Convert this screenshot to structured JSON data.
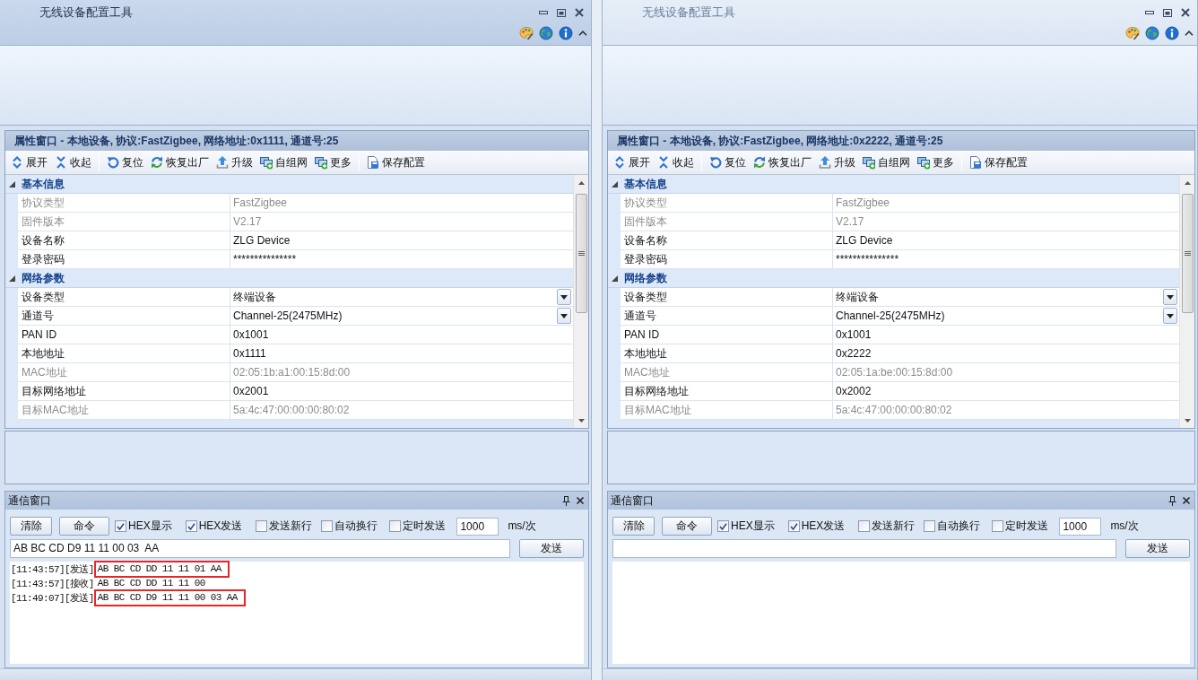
{
  "windows": [
    {
      "title": "无线设备配置工具",
      "active": true,
      "property_panel": {
        "header": "属性窗口 - 本地设备, 协议:FastZigbee, 网络地址:0x1111, 通道号:25",
        "toolbar_groups": [
          {
            "items": [
              {
                "kind": "expand",
                "label": "展开"
              },
              {
                "kind": "collapse",
                "label": "收起"
              }
            ]
          },
          {
            "items": [
              {
                "kind": "reset",
                "label": "复位"
              },
              {
                "kind": "restore",
                "label": "恢复出厂"
              },
              {
                "kind": "upgrade",
                "label": "升级"
              },
              {
                "kind": "network",
                "label": "自组网"
              },
              {
                "kind": "more",
                "label": "更多"
              }
            ]
          },
          {
            "items": [
              {
                "kind": "save",
                "label": "保存配置"
              }
            ]
          }
        ],
        "groups": [
          {
            "name": "基本信息",
            "expanded": true,
            "rows": [
              {
                "name": "协议类型",
                "value": "FastZigbee",
                "disabled": true,
                "dropdown": false
              },
              {
                "name": "固件版本",
                "value": "V2.17",
                "disabled": true,
                "dropdown": false
              },
              {
                "name": "设备名称",
                "value": "ZLG Device",
                "disabled": false,
                "dropdown": false
              },
              {
                "name": "登录密码",
                "value": "***************",
                "disabled": false,
                "dropdown": false
              }
            ]
          },
          {
            "name": "网络参数",
            "expanded": true,
            "rows": [
              {
                "name": "设备类型",
                "value": "终端设备",
                "disabled": false,
                "dropdown": true
              },
              {
                "name": "通道号",
                "value": "Channel-25(2475MHz)",
                "disabled": false,
                "dropdown": true
              },
              {
                "name": "PAN ID",
                "value": "0x1001",
                "disabled": false,
                "dropdown": false
              },
              {
                "name": "本地地址",
                "value": "0x1111",
                "disabled": false,
                "dropdown": false
              },
              {
                "name": "MAC地址",
                "value": "02:05:1b:a1:00:15:8d:00",
                "disabled": true,
                "dropdown": false
              },
              {
                "name": "目标网络地址",
                "value": "0x2001",
                "disabled": false,
                "dropdown": false
              },
              {
                "name": "目标MAC地址",
                "value": "5a:4c:47:00:00:00:80:02",
                "disabled": true,
                "dropdown": false
              }
            ]
          }
        ]
      },
      "comm_panel": {
        "title": "通信窗口",
        "buttons": [
          "清除",
          "命令"
        ],
        "options": [
          {
            "label": "HEX显示",
            "checked": true
          },
          {
            "label": "HEX发送",
            "checked": true
          },
          {
            "label": "发送新行",
            "checked": false
          },
          {
            "label": "自动换行",
            "checked": false
          },
          {
            "label": "定时发送",
            "checked": false
          }
        ],
        "interval": "1000",
        "interval_unit": "ms/次",
        "input": "AB BC CD D9 11 11 00 03  AA",
        "send_button": "发送",
        "log": [
          {
            "prefix": "[11:43:57][发送]",
            "data": "AB BC CD DD 11 11 01 AA",
            "highlighted": true
          },
          {
            "prefix": "[11:43:57][接收]",
            "data": "AB BC CD DD 11 11 00",
            "highlighted": false
          },
          {
            "prefix": "[11:49:07][发送]",
            "data": "AB BC CD D9 11 11 00 03 AA",
            "highlighted": true
          }
        ]
      }
    },
    {
      "title": "无线设备配置工具",
      "active": false,
      "property_panel": {
        "header": "属性窗口 - 本地设备, 协议:FastZigbee, 网络地址:0x2222, 通道号:25",
        "toolbar_groups": [
          {
            "items": [
              {
                "kind": "expand",
                "label": "展开"
              },
              {
                "kind": "collapse",
                "label": "收起"
              }
            ]
          },
          {
            "items": [
              {
                "kind": "reset",
                "label": "复位"
              },
              {
                "kind": "restore",
                "label": "恢复出厂"
              },
              {
                "kind": "upgrade",
                "label": "升级"
              },
              {
                "kind": "network",
                "label": "自组网"
              },
              {
                "kind": "more",
                "label": "更多"
              }
            ]
          },
          {
            "items": [
              {
                "kind": "save",
                "label": "保存配置"
              }
            ]
          }
        ],
        "groups": [
          {
            "name": "基本信息",
            "expanded": true,
            "rows": [
              {
                "name": "协议类型",
                "value": "FastZigbee",
                "disabled": true,
                "dropdown": false
              },
              {
                "name": "固件版本",
                "value": "V2.17",
                "disabled": true,
                "dropdown": false
              },
              {
                "name": "设备名称",
                "value": "ZLG Device",
                "disabled": false,
                "dropdown": false
              },
              {
                "name": "登录密码",
                "value": "***************",
                "disabled": false,
                "dropdown": false
              }
            ]
          },
          {
            "name": "网络参数",
            "expanded": true,
            "rows": [
              {
                "name": "设备类型",
                "value": "终端设备",
                "disabled": false,
                "dropdown": true
              },
              {
                "name": "通道号",
                "value": "Channel-25(2475MHz)",
                "disabled": false,
                "dropdown": true
              },
              {
                "name": "PAN ID",
                "value": "0x1001",
                "disabled": false,
                "dropdown": false
              },
              {
                "name": "本地地址",
                "value": "0x2222",
                "disabled": false,
                "dropdown": false
              },
              {
                "name": "MAC地址",
                "value": "02:05:1a:be:00:15:8d:00",
                "disabled": true,
                "dropdown": false
              },
              {
                "name": "目标网络地址",
                "value": "0x2002",
                "disabled": false,
                "dropdown": false
              },
              {
                "name": "目标MAC地址",
                "value": "5a:4c:47:00:00:00:80:02",
                "disabled": true,
                "dropdown": false
              }
            ]
          }
        ]
      },
      "comm_panel": {
        "title": "通信窗口",
        "buttons": [
          "清除",
          "命令"
        ],
        "options": [
          {
            "label": "HEX显示",
            "checked": true
          },
          {
            "label": "HEX发送",
            "checked": true
          },
          {
            "label": "发送新行",
            "checked": false
          },
          {
            "label": "自动换行",
            "checked": false
          },
          {
            "label": "定时发送",
            "checked": false
          }
        ],
        "interval": "1000",
        "interval_unit": "ms/次",
        "send_button": "发送"
      }
    }
  ]
}
